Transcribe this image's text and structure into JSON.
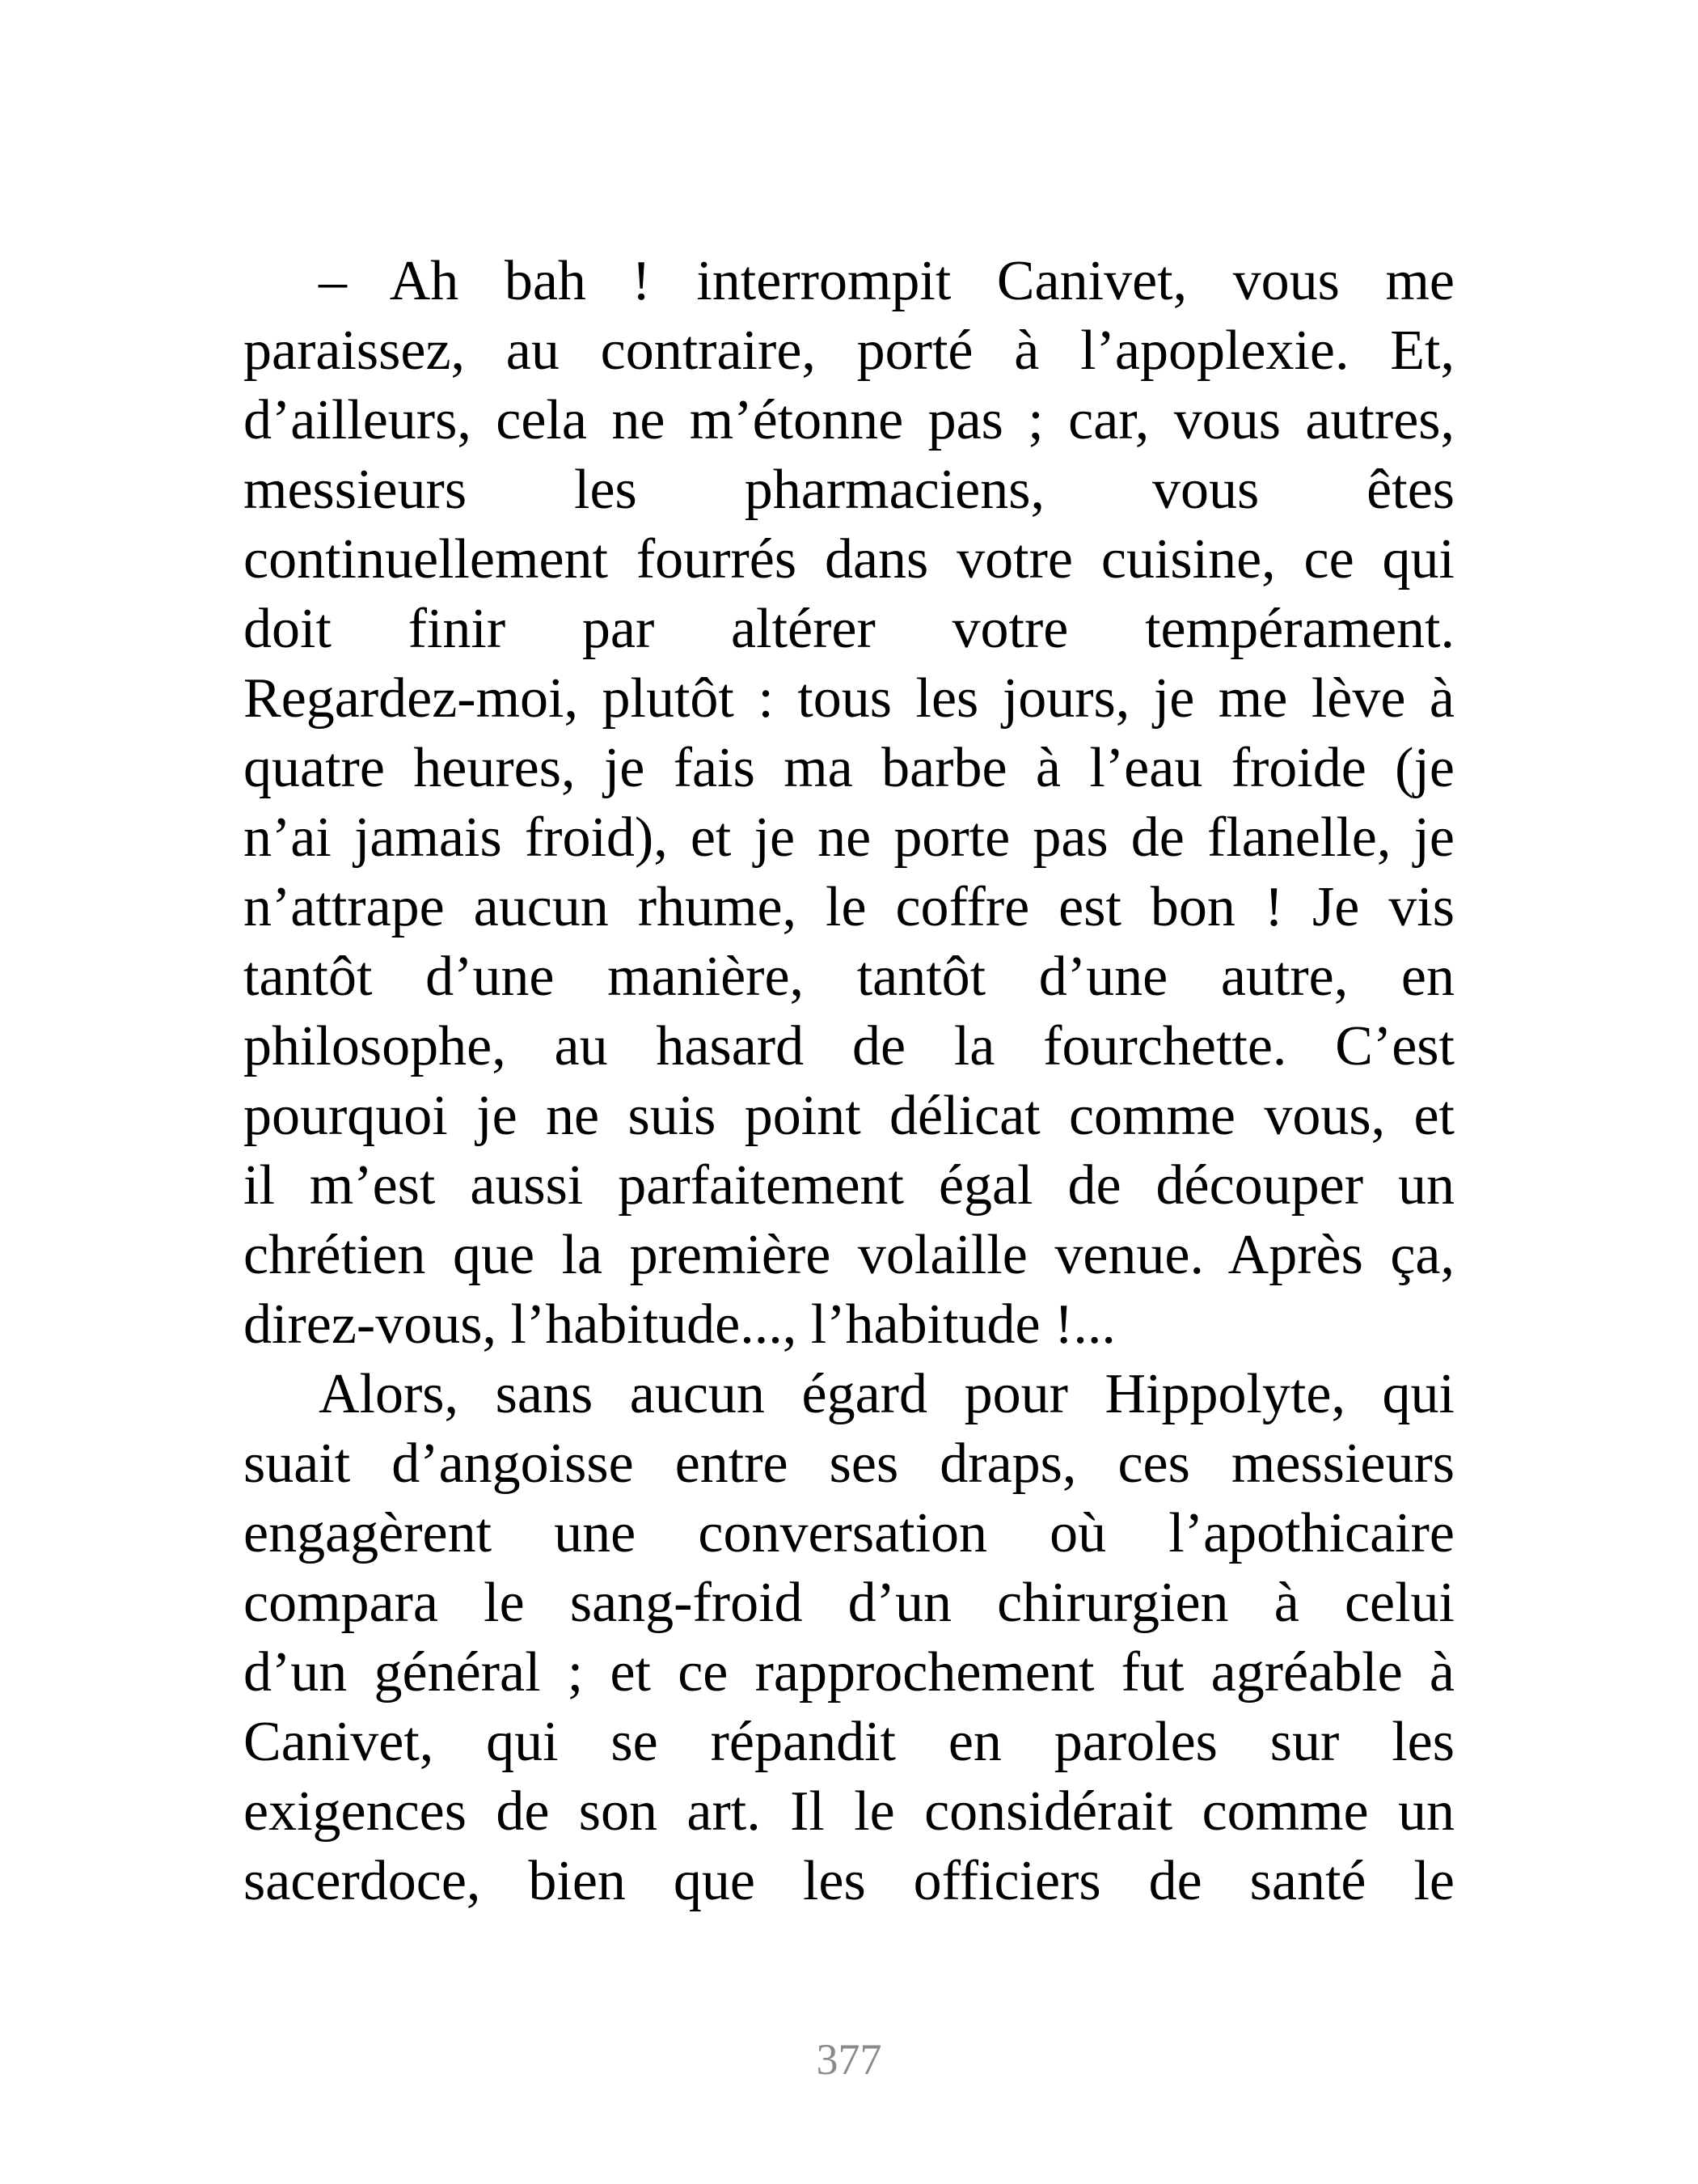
{
  "paragraphs": [
    {
      "lines": [
        "– Ah bah ! interrompit Canivet, vous me",
        "paraissez, au contraire, porté à l’apoplexie. Et,",
        "d’ailleurs, cela ne m’étonne pas ; car, vous autres,",
        "messieurs les pharmaciens, vous êtes",
        "continuellement fourrés dans votre cuisine, ce qui",
        "doit finir par altérer votre tempérament.",
        "Regardez-moi, plutôt : tous les jours, je me lève à",
        "quatre heures, je fais ma barbe à l’eau froide (je",
        "n’ai jamais froid), et je ne porte pas de flanelle, je",
        "n’attrape aucun rhume, le coffre est bon ! Je vis",
        "tantôt d’une manière, tantôt d’une autre, en",
        "philosophe, au hasard de la fourchette. C’est",
        "pourquoi je ne suis point délicat comme vous, et",
        "il m’est aussi parfaitement égal de découper un",
        "chrétien que la première volaille venue. Après ça,",
        "direz-vous, l’habitude..., l’habitude !..."
      ]
    },
    {
      "lines": [
        "Alors, sans aucun égard pour Hippolyte, qui",
        "suait d’angoisse entre ses draps, ces messieurs",
        "engagèrent une conversation où l’apothicaire",
        "compara le sang-froid d’un chirurgien à celui",
        "d’un général ; et ce rapprochement fut agréable à",
        "Canivet, qui se répandit en paroles sur les",
        "exigences de son art. Il le considérait comme un",
        "sacerdoce, bien que les officiers de santé le"
      ]
    }
  ],
  "page_number": "377"
}
